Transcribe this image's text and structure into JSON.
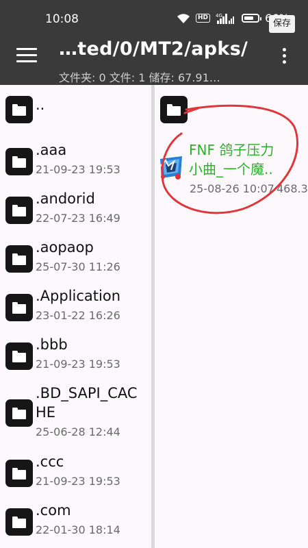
{
  "status": {
    "time": "10:08",
    "hd": "HD",
    "battery": "66%",
    "save_chip": "保存",
    "icons": [
      "wifi-icon",
      "hd-icon",
      "signal-icon",
      "battery-icon"
    ]
  },
  "appbar": {
    "path": "…ted/0/MT2/apks/",
    "info": "文件夹: 0  文件: 1  储存: 67.91…",
    "menu_icon": "hamburger-menu-icon",
    "more_icon": "more-vert-icon"
  },
  "left_pane": {
    "items": [
      {
        "name": "..",
        "date": ""
      },
      {
        "name": ".aaa",
        "date": "21-09-23 19:53"
      },
      {
        "name": ".andorid",
        "date": "22-07-23 16:49"
      },
      {
        "name": ".aopaop",
        "date": "25-07-30 11:26"
      },
      {
        "name": ".Application",
        "date": "23-01-22 16:26"
      },
      {
        "name": ".bbb",
        "date": "21-09-23 19:53"
      },
      {
        "name": ".BD_SAPI_CACHE",
        "name_line1": ".BD_SAPI_CAC",
        "name_line2": "HE",
        "date": "25-06-28 12:44"
      },
      {
        "name": ".ccc",
        "date": "21-09-23 19:53"
      },
      {
        "name": ".com",
        "date": "22-01-30 18:14"
      }
    ]
  },
  "right_pane": {
    "parent": {
      "name": ".."
    },
    "apk": {
      "name_line1": "FNF 鸽子压力",
      "name_line2": "小曲_一个魔..",
      "date": "25-08-26 10:07",
      "size": "468.3",
      "icon": "fnf-app-icon"
    }
  },
  "colors": {
    "header_bg": "#3a3a3a",
    "apk_name": "#2bb02b",
    "annotation": "#e0353a"
  }
}
